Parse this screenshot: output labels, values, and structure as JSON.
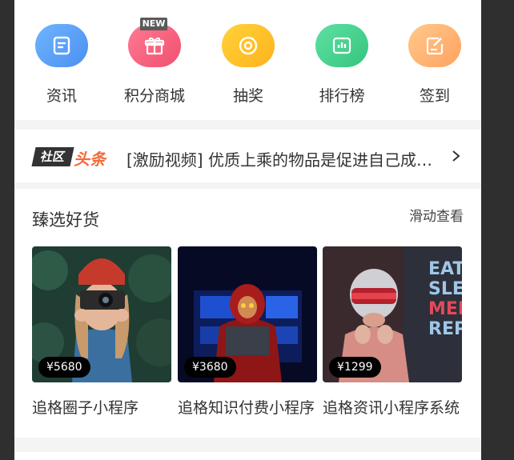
{
  "nav_icons": [
    {
      "label": "资讯",
      "icon": "news-icon",
      "color_from": "#6fb5ff",
      "color_to": "#4b8ff1"
    },
    {
      "label": "积分商城",
      "icon": "gift-icon",
      "color_from": "#ff7a93",
      "color_to": "#f0506e",
      "badge": "NEW"
    },
    {
      "label": "抽奖",
      "icon": "lottery-icon",
      "color_from": "#ffd23a",
      "color_to": "#ffb21c"
    },
    {
      "label": "排行榜",
      "icon": "chart-icon",
      "color_from": "#5fe0a3",
      "color_to": "#35c57d"
    },
    {
      "label": "签到",
      "icon": "checkin-icon",
      "color_from": "#ffc98a",
      "color_to": "#ffa260"
    }
  ],
  "ticker": {
    "logo_left": "社区",
    "logo_right": "头条",
    "text": "[激励视频] 优质上乘的物品是促进自己成长的关键"
  },
  "goods": {
    "title": "臻选好货",
    "more": "滑动查看",
    "items": [
      {
        "price": "¥5680",
        "name": "追格圈子小程序"
      },
      {
        "price": "¥3680",
        "name": "追格知识付费小程序"
      },
      {
        "price": "¥1299",
        "name": "追格资讯小程序系统"
      }
    ]
  },
  "colors": {
    "accent": "#f46a3a",
    "background": "#f4f4f4"
  }
}
